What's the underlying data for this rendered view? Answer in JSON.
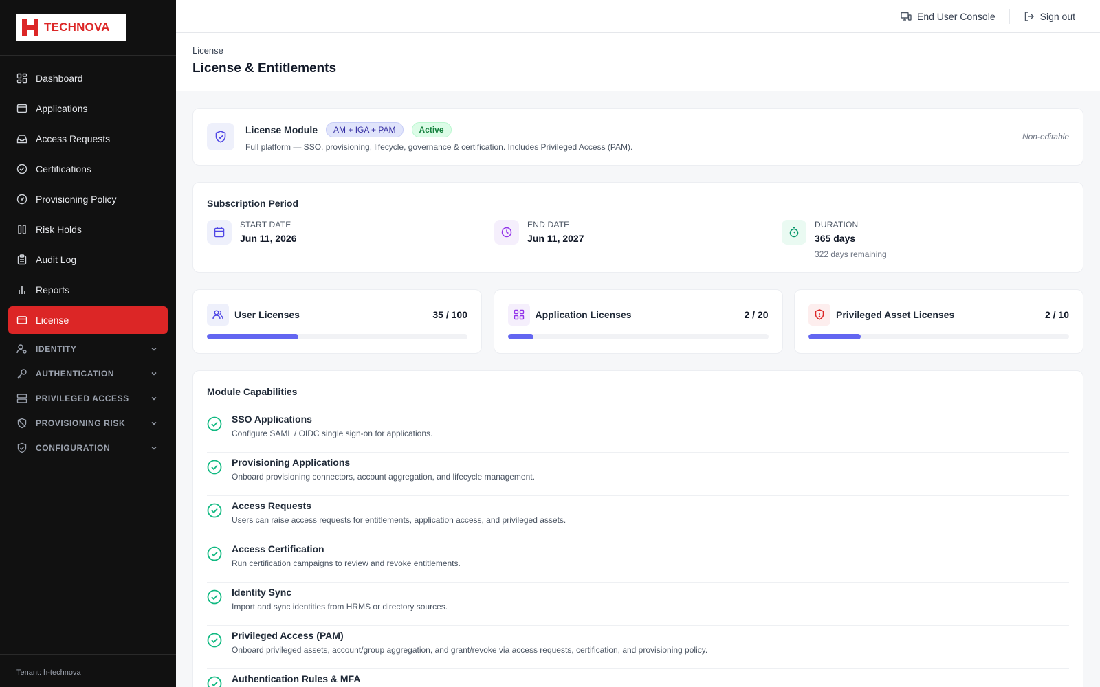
{
  "brand": {
    "name": "TECHNOVA",
    "colors": {
      "primary": "#dc2626",
      "accent": "#6366f1",
      "success": "#16a34a"
    }
  },
  "sidebar": {
    "items": [
      {
        "label": "Dashboard",
        "icon": "dashboard-icon"
      },
      {
        "label": "Applications",
        "icon": "browser-window-icon"
      },
      {
        "label": "Access Requests",
        "icon": "inbox-icon"
      },
      {
        "label": "Certifications",
        "icon": "check-circle-icon"
      },
      {
        "label": "Provisioning Policy",
        "icon": "gauge-icon"
      },
      {
        "label": "Risk Holds",
        "icon": "pause-columns-icon"
      },
      {
        "label": "Audit Log",
        "icon": "clipboard-icon"
      },
      {
        "label": "Reports",
        "icon": "bar-chart-icon"
      },
      {
        "label": "License",
        "icon": "credit-card-icon",
        "active": true
      }
    ],
    "sections": [
      {
        "label": "IDENTITY",
        "icon": "user-cog-icon"
      },
      {
        "label": "AUTHENTICATION",
        "icon": "key-icon"
      },
      {
        "label": "PRIVILEGED ACCESS",
        "icon": "server-icon"
      },
      {
        "label": "PROVISIONING RISK",
        "icon": "shield-off-icon"
      },
      {
        "label": "CONFIGURATION",
        "icon": "shield-check-icon"
      }
    ],
    "tenant": "Tenant: h-technova"
  },
  "header": {
    "end_user_console": "End User Console",
    "sign_out": "Sign out"
  },
  "page": {
    "breadcrumb": "License",
    "title": "License & Entitlements"
  },
  "module": {
    "label": "License Module",
    "tier": "AM + IGA + PAM",
    "status": "Active",
    "description": "Full platform — SSO, provisioning, lifecycle, governance & certification. Includes Privileged Access (PAM).",
    "editability": "Non-editable"
  },
  "subscription": {
    "title": "Subscription Period",
    "start": {
      "label": "START DATE",
      "value": "Jun 11, 2026"
    },
    "end": {
      "label": "END DATE",
      "value": "Jun 11, 2027"
    },
    "duration": {
      "label": "DURATION",
      "value": "365 days",
      "note": "322 days remaining"
    }
  },
  "licenses": [
    {
      "name": "User Licenses",
      "count": "35 / 100",
      "used": 35,
      "total": 100,
      "icon": "users-icon"
    },
    {
      "name": "Application Licenses",
      "count": "2 / 20",
      "used": 2,
      "total": 20,
      "icon": "grid-icon"
    },
    {
      "name": "Privileged Asset Licenses",
      "count": "2 / 10",
      "used": 2,
      "total": 10,
      "icon": "shield-alert-icon"
    }
  ],
  "capabilities": {
    "title": "Module Capabilities",
    "items": [
      {
        "name": "SSO Applications",
        "desc": "Configure SAML / OIDC single sign-on for applications."
      },
      {
        "name": "Provisioning Applications",
        "desc": "Onboard provisioning connectors, account aggregation, and lifecycle management."
      },
      {
        "name": "Access Requests",
        "desc": "Users can raise access requests for entitlements, application access, and privileged assets."
      },
      {
        "name": "Access Certification",
        "desc": "Run certification campaigns to review and revoke entitlements."
      },
      {
        "name": "Identity Sync",
        "desc": "Import and sync identities from HRMS or directory sources."
      },
      {
        "name": "Privileged Access (PAM)",
        "desc": "Onboard privileged assets, account/group aggregation, and grant/revoke via access requests, certification, and provisioning policy."
      },
      {
        "name": "Authentication Rules & MFA",
        "desc": ""
      }
    ]
  }
}
